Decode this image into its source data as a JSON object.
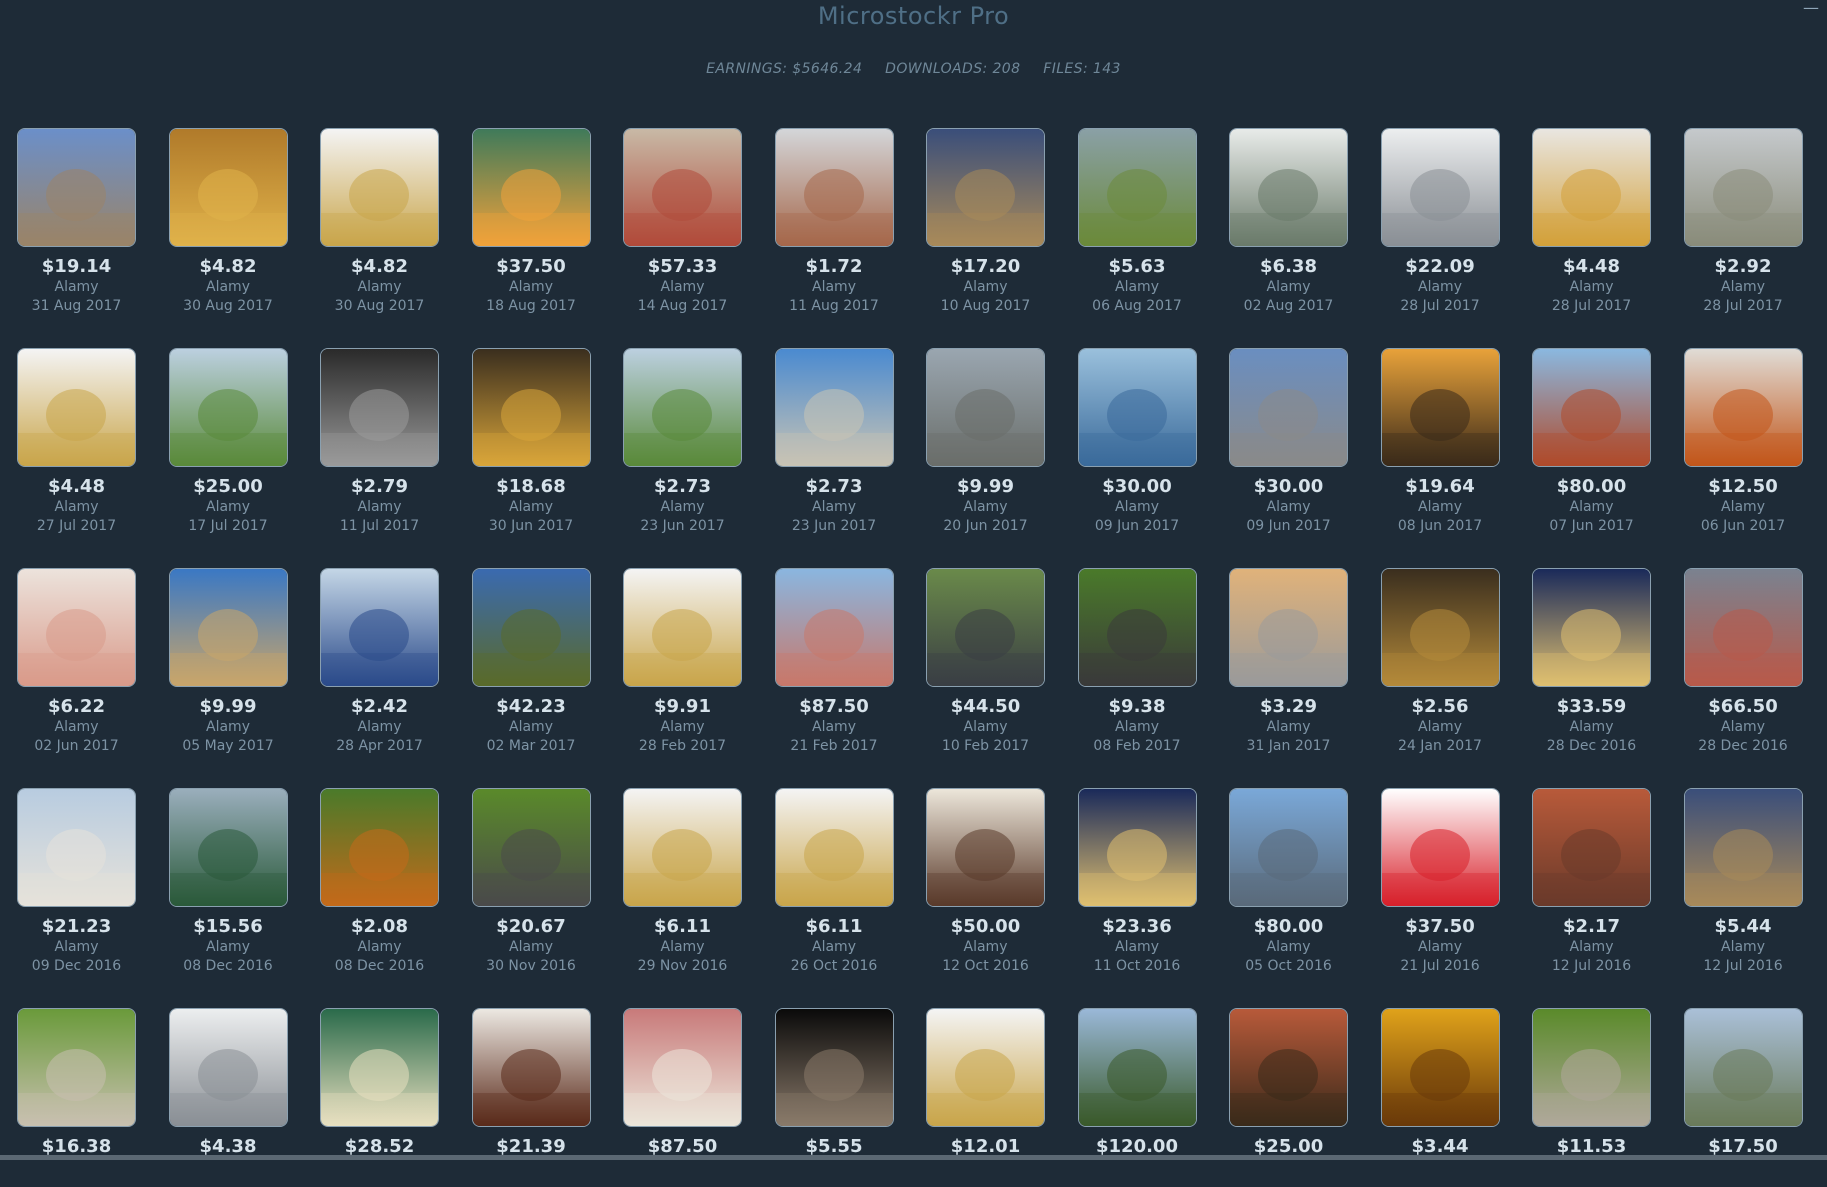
{
  "app": {
    "title": "Microstockr Pro",
    "window_control": "—"
  },
  "stats": {
    "earnings": "EARNINGS: $5646.24",
    "downloads": "DOWNLOADS: 208",
    "files": "FILES: 143"
  },
  "items": [
    {
      "price": "$19.14",
      "agency": "Alamy",
      "date": "31 Aug 2017",
      "c1": "#6b8fc9",
      "c2": "#9a8468"
    },
    {
      "price": "$4.82",
      "agency": "Alamy",
      "date": "30 Aug 2017",
      "c1": "#b07a2a",
      "c2": "#e0b24a"
    },
    {
      "price": "$4.82",
      "agency": "Alamy",
      "date": "30 Aug 2017",
      "c1": "#f4f4f4",
      "c2": "#c9a54a"
    },
    {
      "price": "$37.50",
      "agency": "Alamy",
      "date": "18 Aug 2017",
      "c1": "#3f7a5a",
      "c2": "#f2a23a"
    },
    {
      "price": "$57.33",
      "agency": "Alamy",
      "date": "14 Aug 2017",
      "c1": "#c8b9a6",
      "c2": "#b14a3a"
    },
    {
      "price": "$1.72",
      "agency": "Alamy",
      "date": "11 Aug 2017",
      "c1": "#d4d6d9",
      "c2": "#a5674a"
    },
    {
      "price": "$17.20",
      "agency": "Alamy",
      "date": "10 Aug 2017",
      "c1": "#3a4e7a",
      "c2": "#a88a5a"
    },
    {
      "price": "$5.63",
      "agency": "Alamy",
      "date": "06 Aug 2017",
      "c1": "#8aa0a6",
      "c2": "#6b8a3a"
    },
    {
      "price": "$6.38",
      "agency": "Alamy",
      "date": "02 Aug 2017",
      "c1": "#e8ebe9",
      "c2": "#6a7a6a"
    },
    {
      "price": "$22.09",
      "agency": "Alamy",
      "date": "28 Jul 2017",
      "c1": "#eceeef",
      "c2": "#8a8f95"
    },
    {
      "price": "$4.48",
      "agency": "Alamy",
      "date": "28 Jul 2017",
      "c1": "#e9e6e1",
      "c2": "#d3a13a"
    },
    {
      "price": "$2.92",
      "agency": "Alamy",
      "date": "28 Jul 2017",
      "c1": "#c5c9cc",
      "c2": "#8a8c7a"
    },
    {
      "price": "$4.48",
      "agency": "Alamy",
      "date": "27 Jul 2017",
      "c1": "#f4f4f4",
      "c2": "#c9a54a"
    },
    {
      "price": "$25.00",
      "agency": "Alamy",
      "date": "17 Jul 2017",
      "c1": "#bcd0e0",
      "c2": "#5a8a3a"
    },
    {
      "price": "$2.79",
      "agency": "Alamy",
      "date": "11 Jul 2017",
      "c1": "#2a2a2a",
      "c2": "#9a9a9a"
    },
    {
      "price": "$18.68",
      "agency": "Alamy",
      "date": "30 Jun 2017",
      "c1": "#3a2e1e",
      "c2": "#d9a53a"
    },
    {
      "price": "$2.73",
      "agency": "Alamy",
      "date": "23 Jun 2017",
      "c1": "#bcd0e0",
      "c2": "#5a8a3a"
    },
    {
      "price": "$2.73",
      "agency": "Alamy",
      "date": "23 Jun 2017",
      "c1": "#4a8ad0",
      "c2": "#c9c4b4"
    },
    {
      "price": "$9.99",
      "agency": "Alamy",
      "date": "20 Jun 2017",
      "c1": "#9aa6b0",
      "c2": "#6a6e6a"
    },
    {
      "price": "$30.00",
      "agency": "Alamy",
      "date": "09 Jun 2017",
      "c1": "#9ac0dc",
      "c2": "#3a6a9a"
    },
    {
      "price": "$30.00",
      "agency": "Alamy",
      "date": "09 Jun 2017",
      "c1": "#6a8ec0",
      "c2": "#8a8a8a"
    },
    {
      "price": "$19.64",
      "agency": "Alamy",
      "date": "08 Jun 2017",
      "c1": "#e8a23a",
      "c2": "#3a2a1a"
    },
    {
      "price": "$80.00",
      "agency": "Alamy",
      "date": "07 Jun 2017",
      "c1": "#8ab8e0",
      "c2": "#b04a2a"
    },
    {
      "price": "$12.50",
      "agency": "Alamy",
      "date": "06 Jun 2017",
      "c1": "#e0dcd6",
      "c2": "#c2561a"
    },
    {
      "price": "$6.22",
      "agency": "Alamy",
      "date": "02 Jun 2017",
      "c1": "#ece3dc",
      "c2": "#d99a8a"
    },
    {
      "price": "$9.99",
      "agency": "Alamy",
      "date": "05 May 2017",
      "c1": "#3a78c4",
      "c2": "#c9a56a"
    },
    {
      "price": "$2.42",
      "agency": "Alamy",
      "date": "28 Apr 2017",
      "c1": "#c4d6e6",
      "c2": "#2a4a8a"
    },
    {
      "price": "$42.23",
      "agency": "Alamy",
      "date": "02 Mar 2017",
      "c1": "#3a6ab0",
      "c2": "#5a6a2a"
    },
    {
      "price": "$9.91",
      "agency": "Alamy",
      "date": "28 Feb 2017",
      "c1": "#f4f4f4",
      "c2": "#c9a54a"
    },
    {
      "price": "$87.50",
      "agency": "Alamy",
      "date": "21 Feb 2017",
      "c1": "#8ab6e0",
      "c2": "#c8786a"
    },
    {
      "price": "$44.50",
      "agency": "Alamy",
      "date": "10 Feb 2017",
      "c1": "#6a8a4a",
      "c2": "#3a3e44"
    },
    {
      "price": "$9.38",
      "agency": "Alamy",
      "date": "08 Feb 2017",
      "c1": "#4a7a2a",
      "c2": "#3a3a3a"
    },
    {
      "price": "$3.29",
      "agency": "Alamy",
      "date": "31 Jan 2017",
      "c1": "#e0b27a",
      "c2": "#9a9a9a"
    },
    {
      "price": "$2.56",
      "agency": "Alamy",
      "date": "24 Jan 2017",
      "c1": "#3a2e1e",
      "c2": "#b48a3a"
    },
    {
      "price": "$33.59",
      "agency": "Alamy",
      "date": "28 Dec 2016",
      "c1": "#1a2a5a",
      "c2": "#e0c070"
    },
    {
      "price": "$66.50",
      "agency": "Alamy",
      "date": "28 Dec 2016",
      "c1": "#7a8290",
      "c2": "#b85a4a"
    },
    {
      "price": "$21.23",
      "agency": "Alamy",
      "date": "09 Dec 2016",
      "c1": "#b8cce0",
      "c2": "#e6e2da"
    },
    {
      "price": "$15.56",
      "agency": "Alamy",
      "date": "08 Dec 2016",
      "c1": "#9aaebc",
      "c2": "#2a5a3a"
    },
    {
      "price": "$2.08",
      "agency": "Alamy",
      "date": "08 Dec 2016",
      "c1": "#4a7a2a",
      "c2": "#c46a1a"
    },
    {
      "price": "$20.67",
      "agency": "Alamy",
      "date": "30 Nov 2016",
      "c1": "#5a8a2a",
      "c2": "#4a4a4a"
    },
    {
      "price": "$6.11",
      "agency": "Alamy",
      "date": "29 Nov 2016",
      "c1": "#f4f4f4",
      "c2": "#c9a54a"
    },
    {
      "price": "$6.11",
      "agency": "Alamy",
      "date": "26 Oct 2016",
      "c1": "#f4f4f4",
      "c2": "#c9a54a"
    },
    {
      "price": "$50.00",
      "agency": "Alamy",
      "date": "12 Oct 2016",
      "c1": "#ece6da",
      "c2": "#5a3a2a"
    },
    {
      "price": "$23.36",
      "agency": "Alamy",
      "date": "11 Oct 2016",
      "c1": "#1a2a5a",
      "c2": "#e0c070"
    },
    {
      "price": "$80.00",
      "agency": "Alamy",
      "date": "05 Oct 2016",
      "c1": "#7aa8d8",
      "c2": "#5a6a7a"
    },
    {
      "price": "$37.50",
      "agency": "Alamy",
      "date": "21 Jul 2016",
      "c1": "#ffffff",
      "c2": "#d8202a"
    },
    {
      "price": "$2.17",
      "agency": "Alamy",
      "date": "12 Jul 2016",
      "c1": "#b85a3a",
      "c2": "#6a3a2a"
    },
    {
      "price": "$5.44",
      "agency": "Alamy",
      "date": "12 Jul 2016",
      "c1": "#3a4e7a",
      "c2": "#a88a5a"
    },
    {
      "price": "$16.38",
      "agency": "",
      "date": "",
      "c1": "#6a9a3a",
      "c2": "#c8c0b0"
    },
    {
      "price": "$4.38",
      "agency": "",
      "date": "",
      "c1": "#eceeef",
      "c2": "#8a8f95"
    },
    {
      "price": "$28.52",
      "agency": "",
      "date": "",
      "c1": "#2a6a4a",
      "c2": "#e8e0c0"
    },
    {
      "price": "$21.39",
      "agency": "",
      "date": "",
      "c1": "#ece8e2",
      "c2": "#5a2a1a"
    },
    {
      "price": "$87.50",
      "agency": "",
      "date": "",
      "c1": "#c87a7a",
      "c2": "#ece6da"
    },
    {
      "price": "$5.55",
      "agency": "",
      "date": "",
      "c1": "#0a0a0a",
      "c2": "#8a7a6a"
    },
    {
      "price": "$12.01",
      "agency": "",
      "date": "",
      "c1": "#f4f4f4",
      "c2": "#c9a54a"
    },
    {
      "price": "$120.00",
      "agency": "",
      "date": "",
      "c1": "#9ab8d8",
      "c2": "#3a5a2a"
    },
    {
      "price": "$25.00",
      "agency": "",
      "date": "",
      "c1": "#b85a3a",
      "c2": "#3a2a1a"
    },
    {
      "price": "$3.44",
      "agency": "",
      "date": "",
      "c1": "#e0a21a",
      "c2": "#6a3a0a"
    },
    {
      "price": "$11.53",
      "agency": "",
      "date": "",
      "c1": "#5a8a2a",
      "c2": "#b0a89a"
    },
    {
      "price": "$17.50",
      "agency": "",
      "date": "",
      "c1": "#aac0d8",
      "c2": "#6a7a5a"
    }
  ]
}
